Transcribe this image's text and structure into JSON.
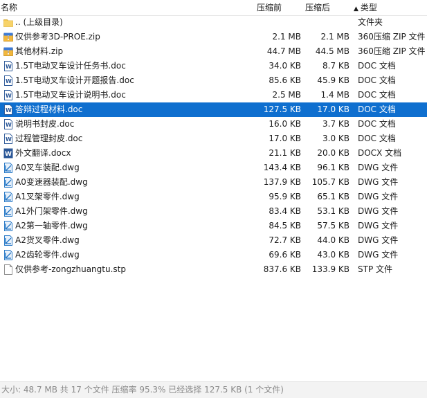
{
  "columns": {
    "name": "名称",
    "compressed": "压缩前",
    "size": "压缩后",
    "type": "类型",
    "sort_indicator": "▲"
  },
  "files": [
    {
      "name": ".. (上级目录)",
      "compressed": "",
      "size": "",
      "type": "文件夹",
      "icon": "folder-icon"
    },
    {
      "name": "仅供参考3D-PROE.zip",
      "compressed": "2.1 MB",
      "size": "2.1 MB",
      "type": "360压缩 ZIP 文件",
      "icon": "zip-archive-icon"
    },
    {
      "name": "其他材料.zip",
      "compressed": "44.7 MB",
      "size": "44.5 MB",
      "type": "360压缩 ZIP 文件",
      "icon": "zip-archive-icon"
    },
    {
      "name": "1.5T电动叉车设计任务书.doc",
      "compressed": "34.0 KB",
      "size": "8.7 KB",
      "type": "DOC 文档",
      "icon": "word-doc-icon"
    },
    {
      "name": "1.5T电动叉车设计开题报告.doc",
      "compressed": "85.6 KB",
      "size": "45.9 KB",
      "type": "DOC 文档",
      "icon": "word-doc-icon"
    },
    {
      "name": "1.5T电动叉车设计说明书.doc",
      "compressed": "2.5 MB",
      "size": "1.4 MB",
      "type": "DOC 文档",
      "icon": "word-doc-icon"
    },
    {
      "name": "答辩过程材料.doc",
      "compressed": "127.5 KB",
      "size": "17.0 KB",
      "type": "DOC 文档",
      "icon": "word-doc-icon",
      "selected": true
    },
    {
      "name": "说明书封皮.doc",
      "compressed": "16.0 KB",
      "size": "3.7 KB",
      "type": "DOC 文档",
      "icon": "word-doc-icon"
    },
    {
      "name": "过程管理封皮.doc",
      "compressed": "17.0 KB",
      "size": "3.0 KB",
      "type": "DOC 文档",
      "icon": "word-doc-icon"
    },
    {
      "name": "外文翻译.docx",
      "compressed": "21.1 KB",
      "size": "20.0 KB",
      "type": "DOCX 文档",
      "icon": "word-docx-icon"
    },
    {
      "name": "A0叉车装配.dwg",
      "compressed": "143.4 KB",
      "size": "96.1 KB",
      "type": "DWG 文件",
      "icon": "dwg-file-icon"
    },
    {
      "name": "A0变速器装配.dwg",
      "compressed": "137.9 KB",
      "size": "105.7 KB",
      "type": "DWG 文件",
      "icon": "dwg-file-icon"
    },
    {
      "name": "A1叉架零件.dwg",
      "compressed": "95.9 KB",
      "size": "65.1 KB",
      "type": "DWG 文件",
      "icon": "dwg-file-icon"
    },
    {
      "name": "A1外门架零件.dwg",
      "compressed": "83.4 KB",
      "size": "53.1 KB",
      "type": "DWG 文件",
      "icon": "dwg-file-icon"
    },
    {
      "name": "A2第一轴零件.dwg",
      "compressed": "84.5 KB",
      "size": "57.5 KB",
      "type": "DWG 文件",
      "icon": "dwg-file-icon"
    },
    {
      "name": "A2货叉零件.dwg",
      "compressed": "72.7 KB",
      "size": "44.0 KB",
      "type": "DWG 文件",
      "icon": "dwg-file-icon"
    },
    {
      "name": "A2齿轮零件.dwg",
      "compressed": "69.6 KB",
      "size": "43.0 KB",
      "type": "DWG 文件",
      "icon": "dwg-file-icon"
    },
    {
      "name": "仅供参考-zongzhuangtu.stp",
      "compressed": "837.6 KB",
      "size": "133.9 KB",
      "type": "STP 文件",
      "icon": "blank-file-icon"
    }
  ],
  "status_bar": {
    "text": "大小: 48.7 MB 共 17 个文件 压缩率 95.3% 已经选择 127.5 KB (1 个文件)"
  },
  "colors": {
    "selection": "#0f6fcf",
    "folder": "#f3c64d",
    "word": "#2b5797",
    "dwg": "#1f73c4"
  }
}
